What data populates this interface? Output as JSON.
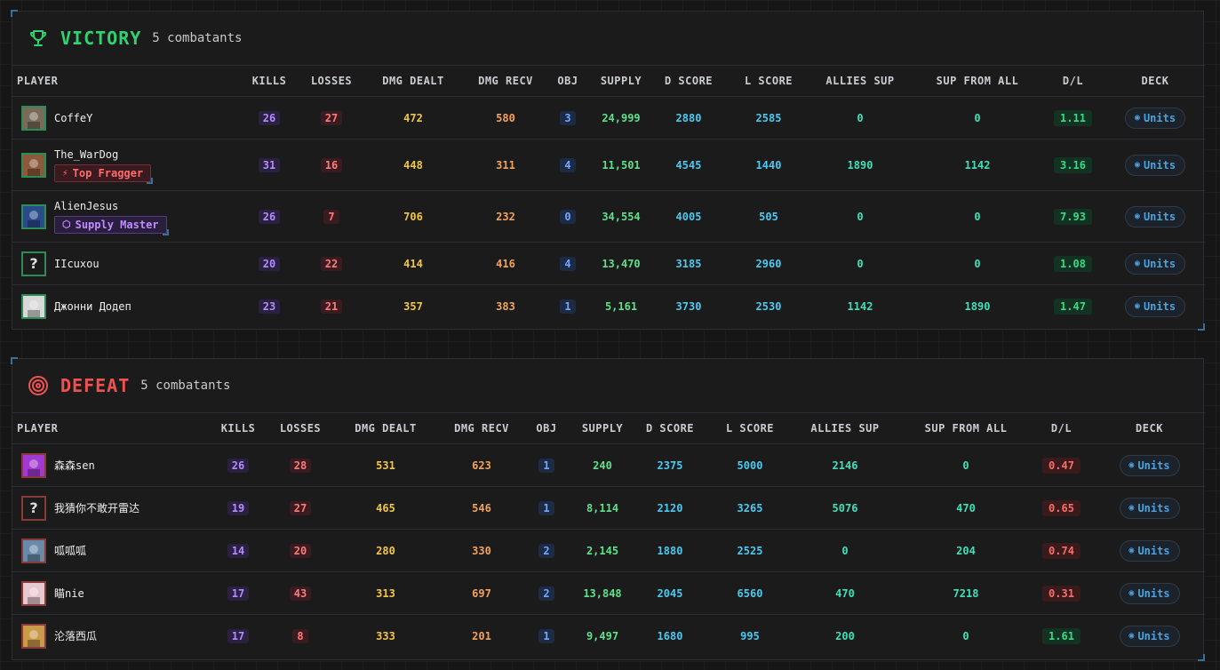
{
  "columns": [
    "PLAYER",
    "KILLS",
    "LOSSES",
    "DMG DEALT",
    "DMG RECV",
    "OBJ",
    "SUPPLY",
    "D SCORE",
    "L SCORE",
    "ALLIES SUP",
    "SUP FROM ALL",
    "D/L",
    "DECK"
  ],
  "deck_label": "Units",
  "victory": {
    "title": "VICTORY",
    "subtitle": "5 combatants",
    "rows": [
      {
        "name": "CoffeY",
        "badge": null,
        "kills": "26",
        "losses": "27",
        "dealt": "472",
        "recv": "580",
        "obj": "3",
        "supply": "24,999",
        "dscore": "2880",
        "lscore": "2585",
        "allies": "0",
        "supall": "0",
        "dl": "1.11",
        "avatar": "soldier-avatar",
        "avatar_color": "#7a6a5a"
      },
      {
        "name": "The_WarDog",
        "badge": "Top Fragger",
        "badge_type": "fragger",
        "kills": "31",
        "losses": "16",
        "dealt": "448",
        "recv": "311",
        "obj": "4",
        "supply": "11,501",
        "dscore": "4545",
        "lscore": "1440",
        "allies": "1890",
        "supall": "1142",
        "dl": "3.16",
        "avatar": "wardog-avatar",
        "avatar_color": "#8a5a3a"
      },
      {
        "name": "AlienJesus",
        "badge": "Supply Master",
        "badge_type": "supply",
        "kills": "26",
        "losses": "7",
        "dealt": "706",
        "recv": "232",
        "obj": "0",
        "supply": "34,554",
        "dscore": "4005",
        "lscore": "505",
        "allies": "0",
        "supall": "0",
        "dl": "7.93",
        "avatar": "alien-avatar",
        "avatar_color": "#2a4a8a"
      },
      {
        "name": "IIcuxou",
        "badge": null,
        "kills": "20",
        "losses": "22",
        "dealt": "414",
        "recv": "416",
        "obj": "4",
        "supply": "13,470",
        "dscore": "3185",
        "lscore": "2960",
        "allies": "0",
        "supall": "0",
        "dl": "1.08",
        "avatar": "unknown-avatar",
        "avatar_color": ""
      },
      {
        "name": "Джонни Додеп",
        "badge": null,
        "kills": "23",
        "losses": "21",
        "dealt": "357",
        "recv": "383",
        "obj": "1",
        "supply": "5,161",
        "dscore": "3730",
        "lscore": "2530",
        "allies": "1142",
        "supall": "1890",
        "dl": "1.47",
        "avatar": "anime-avatar",
        "avatar_color": "#d8d8d8"
      }
    ]
  },
  "defeat": {
    "title": "DEFEAT",
    "subtitle": "5 combatants",
    "rows": [
      {
        "name": "森森sen",
        "kills": "26",
        "losses": "28",
        "dealt": "531",
        "recv": "623",
        "obj": "1",
        "supply": "240",
        "dscore": "2375",
        "lscore": "5000",
        "allies": "2146",
        "supall": "0",
        "dl": "0.47",
        "avatar": "purple-avatar",
        "avatar_color": "#a03ad0"
      },
      {
        "name": "我猜你不敢开雷达",
        "kills": "19",
        "losses": "27",
        "dealt": "465",
        "recv": "546",
        "obj": "1",
        "supply": "8,114",
        "dscore": "2120",
        "lscore": "3265",
        "allies": "5076",
        "supall": "470",
        "dl": "0.65",
        "avatar": "unknown-avatar",
        "avatar_color": ""
      },
      {
        "name": "呱呱呱",
        "kills": "14",
        "losses": "20",
        "dealt": "280",
        "recv": "330",
        "obj": "2",
        "supply": "2,145",
        "dscore": "1880",
        "lscore": "2525",
        "allies": "0",
        "supall": "204",
        "dl": "0.74",
        "avatar": "cap-avatar",
        "avatar_color": "#6a8aaa"
      },
      {
        "name": "瞄nie",
        "kills": "17",
        "losses": "43",
        "dealt": "313",
        "recv": "697",
        "obj": "2",
        "supply": "13,848",
        "dscore": "2045",
        "lscore": "6560",
        "allies": "470",
        "supall": "7218",
        "dl": "0.31",
        "avatar": "pink-avatar",
        "avatar_color": "#e8c8d0"
      },
      {
        "name": "沦落西瓜",
        "kills": "17",
        "losses": "8",
        "dealt": "333",
        "recv": "201",
        "obj": "1",
        "supply": "9,497",
        "dscore": "1680",
        "lscore": "995",
        "allies": "200",
        "supall": "0",
        "dl": "1.61",
        "avatar": "gold-avatar",
        "avatar_color": "#c89a4a"
      }
    ]
  },
  "colors": {
    "victory": "#2fd36f",
    "defeat": "#f05252",
    "accent": "#4aa3df"
  }
}
